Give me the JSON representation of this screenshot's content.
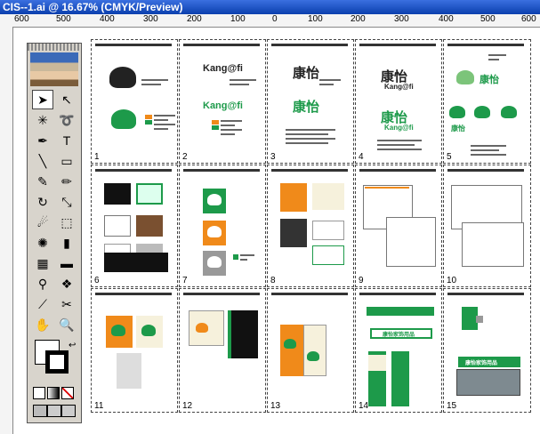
{
  "window": {
    "title": "CIS--1.ai @ 16.67% (CMYK/Preview)"
  },
  "ruler": {
    "labels": [
      "600",
      "500",
      "400",
      "300",
      "200",
      "100",
      "0",
      "100",
      "200",
      "300",
      "400",
      "500",
      "600"
    ]
  },
  "toolbox": {
    "tools": [
      {
        "name": "selection-tool-icon",
        "glyph": "➤"
      },
      {
        "name": "direct-selection-tool-icon",
        "glyph": "↖"
      },
      {
        "name": "magic-wand-tool-icon",
        "glyph": "✳"
      },
      {
        "name": "lasso-tool-icon",
        "glyph": "➰"
      },
      {
        "name": "pen-tool-icon",
        "glyph": "✒"
      },
      {
        "name": "type-tool-icon",
        "glyph": "T"
      },
      {
        "name": "line-tool-icon",
        "glyph": "╲"
      },
      {
        "name": "rectangle-tool-icon",
        "glyph": "▭"
      },
      {
        "name": "paintbrush-tool-icon",
        "glyph": "✎"
      },
      {
        "name": "pencil-tool-icon",
        "glyph": "✏"
      },
      {
        "name": "rotate-tool-icon",
        "glyph": "↻"
      },
      {
        "name": "scale-tool-icon",
        "glyph": "⤡"
      },
      {
        "name": "warp-tool-icon",
        "glyph": "☄"
      },
      {
        "name": "free-transform-tool-icon",
        "glyph": "⬚"
      },
      {
        "name": "symbol-sprayer-tool-icon",
        "glyph": "✺"
      },
      {
        "name": "graph-tool-icon",
        "glyph": "▮"
      },
      {
        "name": "mesh-tool-icon",
        "glyph": "▦"
      },
      {
        "name": "gradient-tool-icon",
        "glyph": "▬"
      },
      {
        "name": "eyedropper-tool-icon",
        "glyph": "⚲"
      },
      {
        "name": "blend-tool-icon",
        "glyph": "❖"
      },
      {
        "name": "slice-tool-icon",
        "glyph": "⟋"
      },
      {
        "name": "scissors-tool-icon",
        "glyph": "✂"
      },
      {
        "name": "hand-tool-icon",
        "glyph": "✋"
      },
      {
        "name": "zoom-tool-icon",
        "glyph": "🔍"
      }
    ]
  },
  "pages": {
    "numbers": [
      "1",
      "2",
      "3",
      "4",
      "5",
      "6",
      "7",
      "8",
      "9",
      "10",
      "11",
      "12",
      "13",
      "14",
      "15"
    ],
    "logo_text_cn": "康怡",
    "logo_text_en": "Kang@fi",
    "store_sign": "康怡家饰用品"
  },
  "colors": {
    "brand_green": "#1d9a4a",
    "brand_orange": "#f08a1a"
  }
}
